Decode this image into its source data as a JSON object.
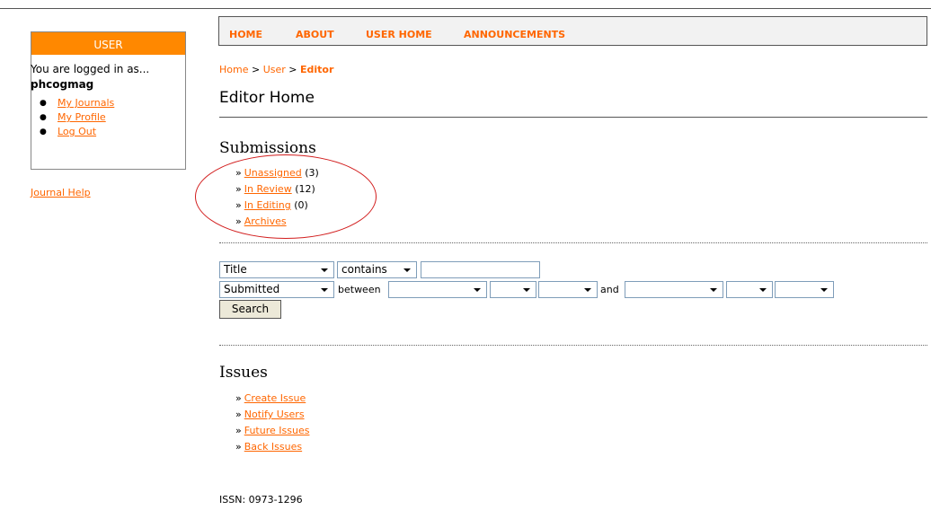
{
  "sidebar": {
    "header": "USER",
    "logged_in_text": "You are logged in as...",
    "username": "phcogmag",
    "links": [
      "My Journals",
      "My Profile",
      "Log Out"
    ],
    "help_link": "Journal Help"
  },
  "nav": {
    "items": [
      "HOME",
      "ABOUT",
      "USER HOME",
      "ANNOUNCEMENTS"
    ]
  },
  "breadcrumb": {
    "home": "Home",
    "separator": ">",
    "user": "User",
    "current": "Editor"
  },
  "page_title": "Editor Home",
  "submissions": {
    "title": "Submissions",
    "arrow": "»",
    "items": [
      {
        "label": "Unassigned",
        "count": "(3)"
      },
      {
        "label": "In Review",
        "count": "(12)"
      },
      {
        "label": "In Editing",
        "count": "(0)"
      },
      {
        "label": "Archives",
        "count": ""
      }
    ]
  },
  "search": {
    "field_select": "Title",
    "match_select": "contains",
    "search_value": "",
    "date_field_select": "Submitted",
    "between_label": "between",
    "and_label": "and",
    "from_month": "",
    "from_day": "",
    "from_year": "",
    "to_month": "",
    "to_day": "",
    "to_year": "",
    "button_label": "Search"
  },
  "issues": {
    "title": "Issues",
    "arrow": "»",
    "items": [
      "Create Issue",
      "Notify Users",
      "Future Issues",
      "Back Issues"
    ]
  },
  "footer": {
    "issn": "ISSN: 0973-1296"
  },
  "colors": {
    "accent": "#ff6600",
    "header_bg": "#ff8800",
    "annotation_circle": "#d21e1e"
  }
}
